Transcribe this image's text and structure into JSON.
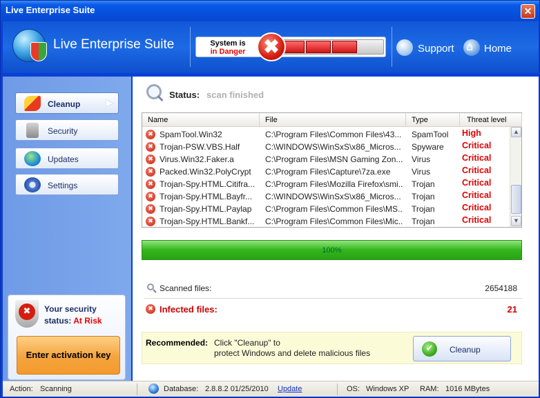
{
  "window": {
    "title": "Live Enterprise Suite",
    "close_glyph": "✕"
  },
  "header": {
    "app_name": "Live Enterprise Suite",
    "danger_line1": "System is",
    "danger_line2": "in Danger",
    "danger_glyph": "✖",
    "support_label": "Support",
    "home_label": "Home"
  },
  "sidebar": {
    "items": [
      {
        "label": "Cleanup",
        "icon": "cleanup-icon",
        "active": true
      },
      {
        "label": "Security",
        "icon": "lock-icon",
        "active": false
      },
      {
        "label": "Updates",
        "icon": "globe-icon",
        "active": false
      },
      {
        "label": "Settings",
        "icon": "gear-icon",
        "active": false
      }
    ],
    "security_status_line1": "Your security",
    "security_status_line2": "status:",
    "security_status_value": "At Risk",
    "activate_label": "Enter activation key"
  },
  "main": {
    "status_label": "Status:",
    "status_value": "scan finished",
    "table": {
      "columns": [
        "Name",
        "File",
        "Type",
        "Threat level"
      ],
      "rows": [
        {
          "name": "SpamTool.Win32",
          "file": "C:\\Program Files\\Common Files\\43...",
          "type": "SpamTool",
          "threat": "High"
        },
        {
          "name": "Trojan-PSW.VBS.Half",
          "file": "C:\\WINDOWS\\WinSxS\\x86_Micros...",
          "type": "Spyware",
          "threat": "Critical"
        },
        {
          "name": "Virus.Win32.Faker.a",
          "file": "C:\\Program Files\\MSN Gaming Zon...",
          "type": "Virus",
          "threat": "Critical"
        },
        {
          "name": "Packed.Win32.PolyCrypt",
          "file": "C:\\Program Files\\Capture\\7za.exe",
          "type": "Virus",
          "threat": "Critical"
        },
        {
          "name": "Trojan-Spy.HTML.Citifra...",
          "file": "C:\\Program Files\\Mozilla Firefox\\smi...",
          "type": "Trojan",
          "threat": "Critical"
        },
        {
          "name": "Trojan-Spy.HTML.Bayfr...",
          "file": "C:\\WINDOWS\\WinSxS\\x86_Micros...",
          "type": "Trojan",
          "threat": "Critical"
        },
        {
          "name": "Trojan-Spy.HTML.Paylap",
          "file": "C:\\Program Files\\Common Files\\MS...",
          "type": "Trojan",
          "threat": "Critical"
        },
        {
          "name": "Trojan-Spy.HTML.Bankf...",
          "file": "C:\\Program Files\\Common Files\\Mic...",
          "type": "Trojan",
          "threat": "Critical"
        }
      ]
    },
    "progress_text": "100%",
    "progress_fraction": 1.0,
    "scanned_label": "Scanned files:",
    "scanned_value": "2654188",
    "infected_label": "Infected files:",
    "infected_value": "21",
    "recommended_label": "Recommended:",
    "recommended_line1": "Click \"Cleanup\" to",
    "recommended_line2": "protect Windows and delete malicious files",
    "cleanup_button": "Cleanup"
  },
  "statusbar": {
    "action_label": "Action:",
    "action_value": "Scanning",
    "database_label": "Database:",
    "database_value": "2.8.8.2 01/25/2010",
    "update_link": "Update",
    "os_label": "OS:",
    "os_value": "Windows XP",
    "ram_label": "RAM:",
    "ram_value": "1016 MBytes"
  },
  "colors": {
    "threat": "#e00000",
    "danger": "#ee0000",
    "accent": "#0a5ae6"
  }
}
